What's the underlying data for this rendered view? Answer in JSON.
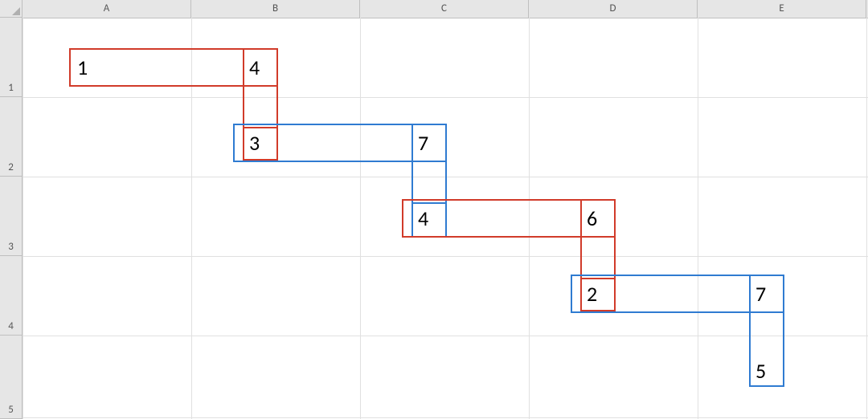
{
  "columns": [
    "A",
    "B",
    "C",
    "D",
    "E"
  ],
  "rows": [
    "1",
    "2",
    "3",
    "4",
    "5"
  ],
  "shapes": {
    "r1_left": "1",
    "r1_right": "4",
    "r2_left": "3",
    "r2_right": "7",
    "r3_left": "4",
    "r3_right": "6",
    "r4_left": "2",
    "r4_right": "7",
    "r5_val": "5"
  },
  "chart_data": {
    "type": "table",
    "note": "Stepped rectangle overlays on Excel grid. Each rectangle spans two cells horizontally.",
    "rects": [
      {
        "row": 1,
        "cols": [
          "A",
          "B"
        ],
        "color": "red",
        "left_val": 1,
        "right_val": 4
      },
      {
        "row": 2,
        "cols": [
          "B",
          "C"
        ],
        "color": "blue",
        "left_val": 3,
        "right_val": 7
      },
      {
        "row": 3,
        "cols": [
          "C",
          "D"
        ],
        "color": "red",
        "left_val": 4,
        "right_val": 6
      },
      {
        "row": 4,
        "cols": [
          "D",
          "E"
        ],
        "color": "blue",
        "left_val": 2,
        "right_val": 7
      },
      {
        "row": 5,
        "cols": [
          "E"
        ],
        "color": "blue",
        "left_val": 5
      }
    ],
    "vertical_links": [
      {
        "between_rows": [
          1,
          2
        ],
        "col": "B",
        "color": "red"
      },
      {
        "between_rows": [
          2,
          3
        ],
        "col": "C",
        "color": "blue"
      },
      {
        "between_rows": [
          3,
          4
        ],
        "col": "D",
        "color": "red"
      },
      {
        "between_rows": [
          4,
          5
        ],
        "col": "E",
        "color": "blue"
      }
    ]
  }
}
